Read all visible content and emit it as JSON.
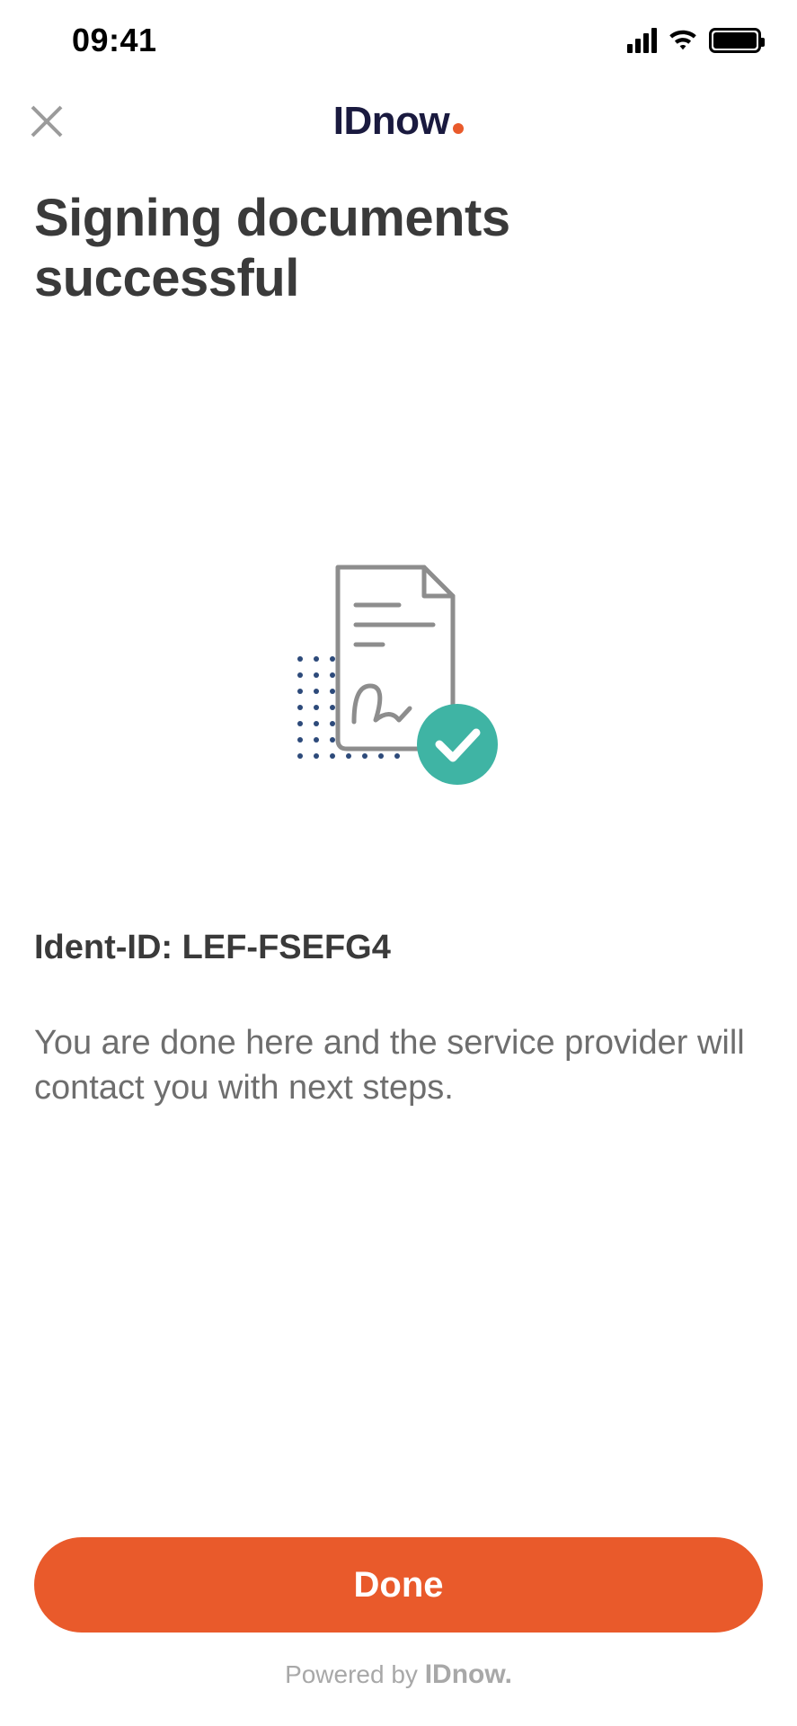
{
  "status": {
    "time": "09:41"
  },
  "header": {
    "logo_text": "IDnow"
  },
  "page": {
    "title": "Signing documents successful",
    "ident_label": "Ident-ID:",
    "ident_value": "LEF-FSEFG4",
    "body": "You are done here and the service provider will contact you with next steps."
  },
  "actions": {
    "done_label": "Done"
  },
  "footer": {
    "powered_by": "Powered by",
    "brand": "IDnow"
  },
  "colors": {
    "accent": "#e95a2b",
    "teal": "#3fb4a4",
    "text_dark": "#3a3a3a",
    "text_muted": "#6e6e6e"
  }
}
